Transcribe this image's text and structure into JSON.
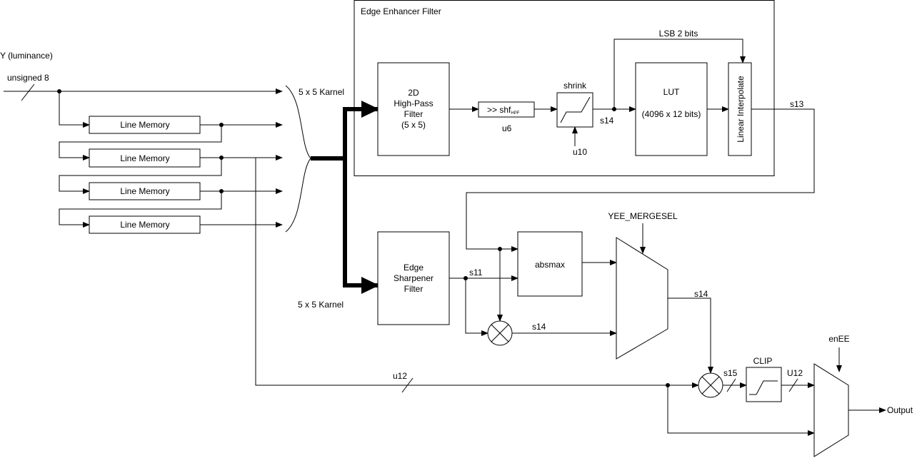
{
  "input": {
    "title": "Y (luminance)",
    "type_label": "unsigned 8"
  },
  "line_memory_label": "Line Memory",
  "kernel_labels": [
    "5 x 5 Karnel",
    "5 x 5 Karnel"
  ],
  "enhancer": {
    "title": "Edge Enhancer Filter",
    "hpf_lines": [
      "2D",
      "High-Pass",
      "Filter",
      "(5 x 5)"
    ],
    "shift_label": ">> shf",
    "shift_subscript": "HPF",
    "shift_width": "u6",
    "shrink_label": "shrink",
    "shrink_param": "u10",
    "shrink_out": "s14",
    "lsb_label": "LSB 2 bits",
    "lut_title": "LUT",
    "lut_size": "(4096 x 12 bits)",
    "interp_label": "Linear Interpolate",
    "out_label": "s13"
  },
  "sharpener": {
    "lines": [
      "Edge",
      "Sharpener",
      "Filter"
    ],
    "out_label": "s11"
  },
  "absmax_label": "absmax",
  "mult_out_label": "s14",
  "mux1": {
    "select": "YEE_MERGESEL",
    "out_label": "s14"
  },
  "bypass_label": "u12",
  "mult2_out_label": "s15",
  "clip": {
    "label": "CLIP",
    "out_label": "U12"
  },
  "mux2": {
    "select": "enEE"
  },
  "output_label": "Output"
}
